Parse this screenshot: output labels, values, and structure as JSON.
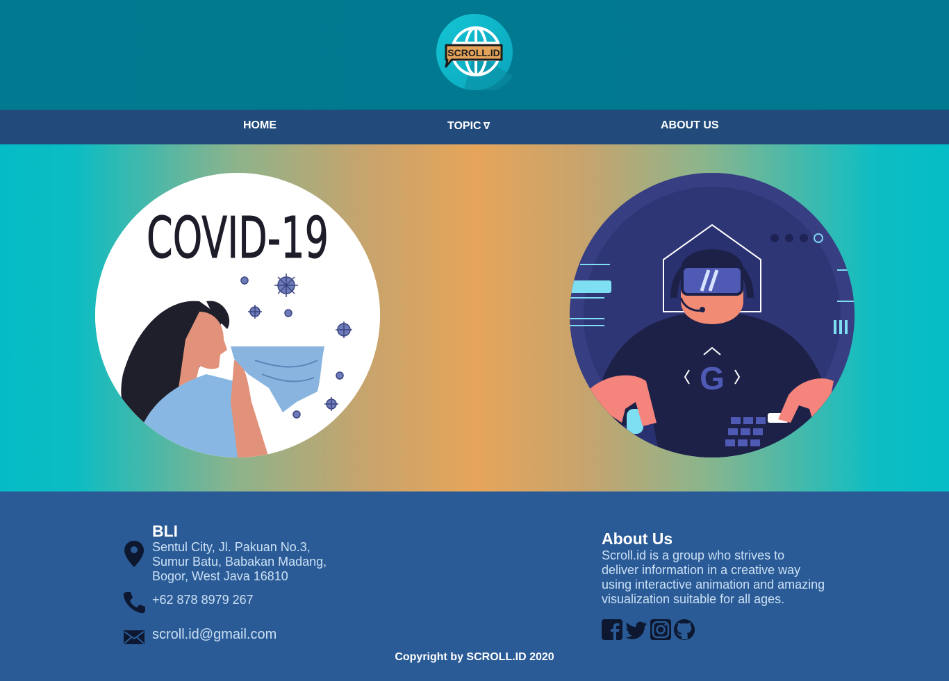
{
  "header": {
    "logo_text": "SCROLL.ID"
  },
  "nav": {
    "home": "HOME",
    "topic": "TOPIC",
    "topic_caret": "∇",
    "about": "ABOUT US"
  },
  "hero": {
    "left_image_text": "COVID-19",
    "right_image_text": "G"
  },
  "footer": {
    "company": "BLI",
    "address_lines": [
      "Sentul City, Jl. Pakuan No.3,",
      "Sumur Batu, Babakan Madang,",
      "Bogor, West Java 16810"
    ],
    "phone": "+62 878 8979 267",
    "email": "scroll.id@gmail.com",
    "about_title": "About Us",
    "about_lines": [
      "Scroll.id is a group who strives to",
      "deliver information in a creative way",
      "using interactive animation and amazing",
      "visualization suitable for all ages."
    ],
    "social_icons": [
      "facebook-icon",
      "twitter-icon",
      "instagram-icon",
      "github-icon"
    ],
    "copyright": "Copyright by  SCROLL.ID 2020"
  },
  "colors": {
    "header": "#017a91",
    "nav": "#224b7c",
    "footer": "#2a5b96",
    "hero_edge": "#04bcc6",
    "hero_center": "#e6a55a"
  }
}
